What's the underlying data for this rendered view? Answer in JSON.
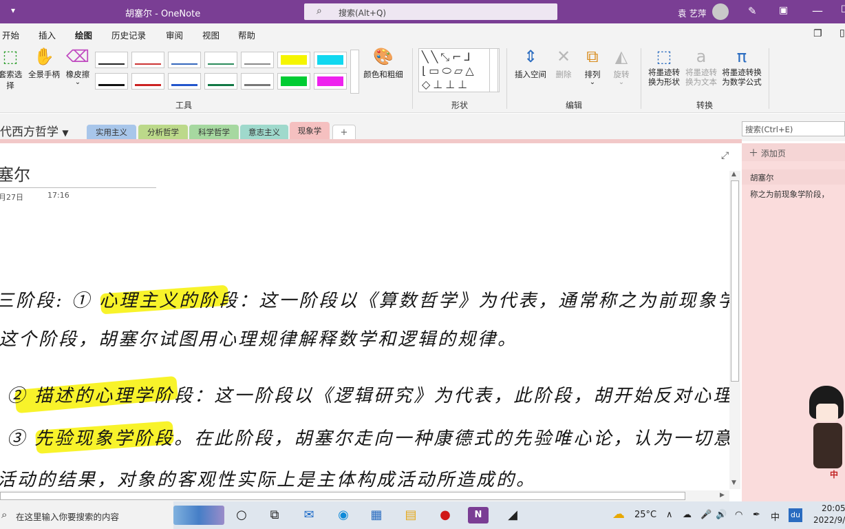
{
  "app": {
    "window_title": "胡塞尔 - OneNote",
    "search_placeholder": "搜索(Alt+Q)",
    "user_name": "袁 艺萍",
    "accent_color": "#7a3e94"
  },
  "menu": [
    "开始",
    "插入",
    "绘图",
    "历史记录",
    "审阅",
    "视图",
    "帮助"
  ],
  "menu_active": "绘图",
  "ribbon": {
    "tools": {
      "lasso": "套索选择",
      "pan": "全景手柄",
      "eraser": "橡皮擦",
      "color_thickness": "颜色和粗细",
      "group_label": "工具",
      "pens_row1": [
        "#222222",
        "#cc3333",
        "#3366bb",
        "#2a8a5a",
        "#888888",
        "#f5f500",
        "#11d8f0"
      ],
      "pens_row2": [
        "#111111",
        "#cc2222",
        "#2255cc",
        "#117744",
        "#777777",
        "#00cc33",
        "#ee22ee"
      ]
    },
    "shapes": {
      "group_label": "形状"
    },
    "edit": {
      "insert_space": "插入空间",
      "delete": "删除",
      "arrange": "排列",
      "rotate": "旋转",
      "group_label": "编辑"
    },
    "convert": {
      "ink_to_shape": "将墨迹转换为形状",
      "ink_to_text": "将墨迹转换为文本",
      "ink_to_math": "将墨迹转换为数学公式",
      "group_label": "转换"
    }
  },
  "notebook": {
    "section_group": "代西方哲学",
    "sections": [
      {
        "label": "实用主义",
        "color": "#a8c6ea"
      },
      {
        "label": "分析哲学",
        "color": "#bcd98a"
      },
      {
        "label": "科学哲学",
        "color": "#a6d8a0"
      },
      {
        "label": "意志主义",
        "color": "#9fd9cc"
      },
      {
        "label": "现象学",
        "color": "#f5c0c0"
      }
    ],
    "add_section": "+",
    "search_placeholder": "搜索(Ctrl+E)"
  },
  "page": {
    "title": "塞尔",
    "date": "月27日",
    "time": "17:16",
    "ink_lines": [
      "三阶段: ① 心理主义的阶段：这一阶段以《算数哲学》为代表，通常称之为前现象学阶",
      "这个阶段，胡塞尔试图用心理规律解释数学和逻辑的规律。",
      "② 描述的心理学阶段：这一阶段以《逻辑研究》为代表，此阶段，胡开始反对心理主义.",
      "③ 先验现象学阶段。在此阶段，胡塞尔走向一种康德式的先验唯心论，认为一切意识活动",
      "活动的结果，对象的客观性实际上是主体构成活动所造成的。"
    ]
  },
  "pages_pane": {
    "add_page": "添加页",
    "pages": [
      "胡塞尔",
      "称之为前现象学阶段，"
    ]
  },
  "taskbar": {
    "search_placeholder": "在这里输入你要搜索的内容",
    "weather": "25°C",
    "time": "20:05",
    "date": "2022/9/",
    "ime": "中"
  }
}
